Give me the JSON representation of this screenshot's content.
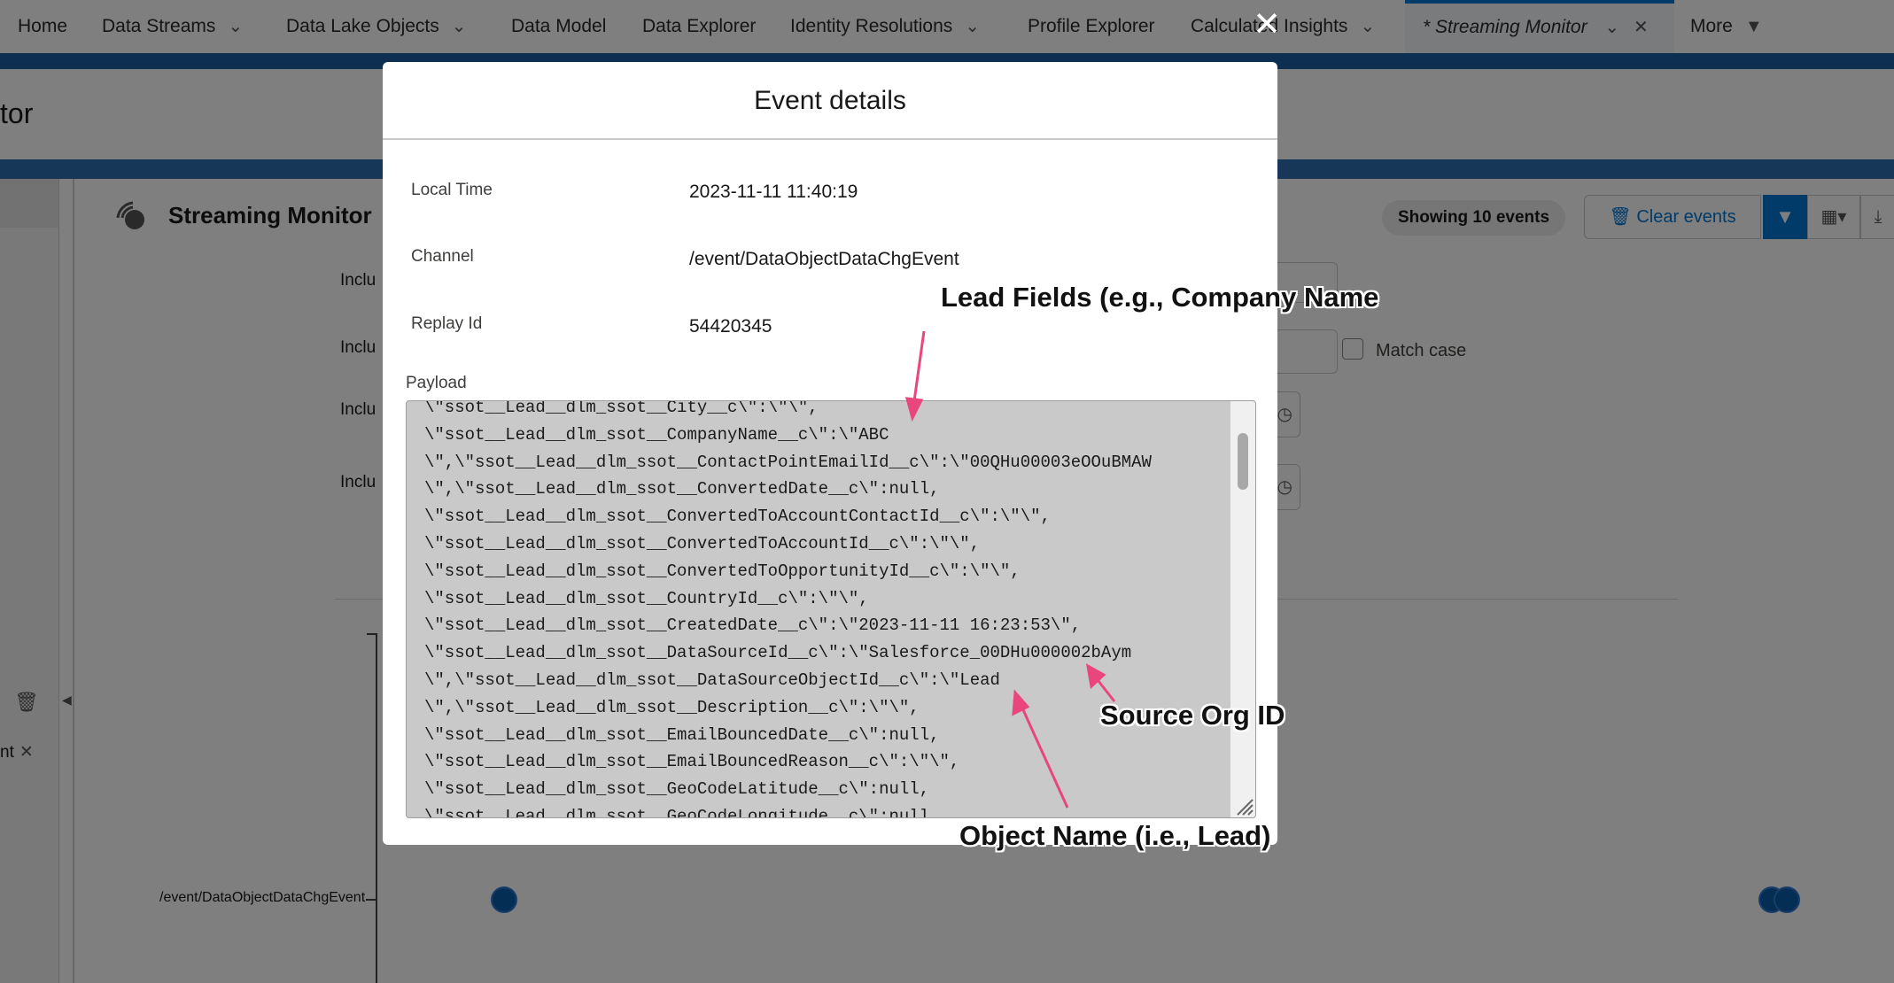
{
  "nav": {
    "items": [
      {
        "label": "Home",
        "chevron": false
      },
      {
        "label": "Data Streams",
        "chevron": true
      },
      {
        "label": "Data Lake Objects",
        "chevron": true
      },
      {
        "label": "Data Model",
        "chevron": false
      },
      {
        "label": "Data Explorer",
        "chevron": false
      },
      {
        "label": "Identity Resolutions",
        "chevron": true
      },
      {
        "label": "Profile Explorer",
        "chevron": false
      },
      {
        "label": "Calculated Insights",
        "chevron": true
      }
    ],
    "active_tab": "* Streaming Monitor",
    "more_label": "More"
  },
  "page": {
    "header_title_partial": "tor"
  },
  "monitor": {
    "title": "Streaming Monitor",
    "showing": "Showing 10 events",
    "clear_label": "Clear events",
    "include_labels": [
      "Inclu",
      "Inclu",
      "Inclu",
      "Inclu"
    ],
    "match_case_label": "Match case",
    "channel_axis_label": "/event/DataObjectDataChgEvent",
    "left_partial": "nt"
  },
  "modal": {
    "title": "Event details",
    "fields": [
      {
        "label": "Local Time",
        "value": "2023-11-11 11:40:19"
      },
      {
        "label": "Channel",
        "value": "/event/DataObjectDataChgEvent"
      },
      {
        "label": "Replay Id",
        "value": "54420345"
      }
    ],
    "payload_label": "Payload",
    "payload_lines": [
      "\\\"ssot__Lead__dlm_ssot__City__c\\\":\\\"\\\",",
      "\\\"ssot__Lead__dlm_ssot__CompanyName__c\\\":\\\"ABC",
      "\\\",\\\"ssot__Lead__dlm_ssot__ContactPointEmailId__c\\\":\\\"00QHu00003eOOuBMAW",
      "\\\",\\\"ssot__Lead__dlm_ssot__ConvertedDate__c\\\":null,",
      "\\\"ssot__Lead__dlm_ssot__ConvertedToAccountContactId__c\\\":\\\"\\\",",
      "\\\"ssot__Lead__dlm_ssot__ConvertedToAccountId__c\\\":\\\"\\\",",
      "\\\"ssot__Lead__dlm_ssot__ConvertedToOpportunityId__c\\\":\\\"\\\",",
      "\\\"ssot__Lead__dlm_ssot__CountryId__c\\\":\\\"\\\",",
      "\\\"ssot__Lead__dlm_ssot__CreatedDate__c\\\":\\\"2023-11-11 16:23:53\\\",",
      "\\\"ssot__Lead__dlm_ssot__DataSourceId__c\\\":\\\"Salesforce_00DHu000002bAym",
      "\\\",\\\"ssot__Lead__dlm_ssot__DataSourceObjectId__c\\\":\\\"Lead",
      "\\\",\\\"ssot__Lead__dlm_ssot__Description__c\\\":\\\"\\\",",
      "\\\"ssot__Lead__dlm_ssot__EmailBouncedDate__c\\\":null,",
      "\\\"ssot__Lead__dlm_ssot__EmailBouncedReason__c\\\":\\\"\\\",",
      "\\\"ssot__Lead__dlm_ssot__GeoCodeLatitude__c\\\":null,",
      "\\\"ssot__Lead__dlm_ssot__GeoCodeLongitude__c\\\":null,"
    ]
  },
  "annotations": {
    "lead_fields": "Lead Fields  (e.g., Company Name",
    "source_org": "Source Org ID",
    "object_name": "Object Name (i.e., Lead)",
    "arrow_color": "#e8467c"
  },
  "colors": {
    "brand_blue": "#0176d3",
    "band_blue": "#1b5fa5"
  }
}
